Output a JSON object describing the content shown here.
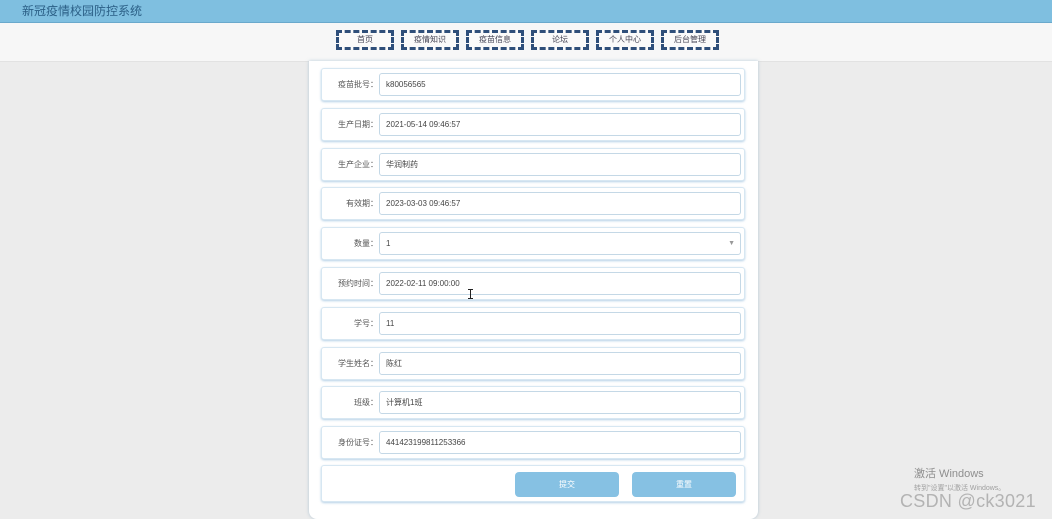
{
  "app": {
    "title": "新冠疫情校园防控系统"
  },
  "nav": {
    "items": [
      "首页",
      "疫情知识",
      "疫苗信息",
      "论坛",
      "个人中心",
      "后台管理"
    ]
  },
  "form": {
    "fields": [
      {
        "label": "疫苗批号：",
        "value": "k80056565"
      },
      {
        "label": "生产日期：",
        "value": "2021-05-14 09:46:57"
      },
      {
        "label": "生产企业：",
        "value": "华润制药"
      },
      {
        "label": "有效期：",
        "value": "2023-03-03 09:46:57"
      },
      {
        "label": "数量：",
        "value": "1"
      },
      {
        "label": "预约时间：",
        "value": "2022-02-11 09:00:00"
      },
      {
        "label": "学号：",
        "value": "11"
      },
      {
        "label": "学生姓名：",
        "value": "陈红"
      },
      {
        "label": "班级：",
        "value": "计算机1班"
      },
      {
        "label": "身份证号：",
        "value": "441423199811253366"
      }
    ],
    "select_arrow": "▼",
    "submit_label": "提交",
    "reset_label": "重置"
  },
  "watermarks": {
    "windows_title": "激活 Windows",
    "windows_sub": "转到\"设置\"以激活 Windows。",
    "csdn": "CSDN @ck3021"
  },
  "colors": {
    "topbar": "#7fbfe0",
    "accent_button": "#86c1e3",
    "nav_border": "#2f4f7a",
    "page_background": "#ececec"
  }
}
